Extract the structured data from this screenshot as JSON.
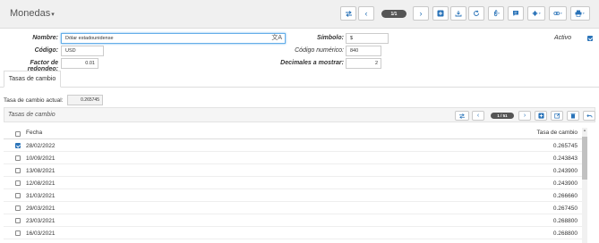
{
  "header": {
    "title": "Monedas",
    "pager": "1/1"
  },
  "form": {
    "nombre_label": "Nombre:",
    "nombre_value": "Dólar estadounidense",
    "simbolo_label": "Símbolo:",
    "simbolo_value": "$",
    "activo_label": "Activo",
    "codigo_label": "Código:",
    "codigo_value": "USD",
    "codigo_num_label": "Código numérico:",
    "codigo_num_value": "840",
    "factor_label": "Factor de redondeo:",
    "factor_value": "0.01",
    "decimales_label": "Decimales a mostrar:",
    "decimales_value": "2"
  },
  "tabs": [
    {
      "label": "Tasas de cambio"
    }
  ],
  "rate_panel": {
    "current_label": "Tasa de cambio actual:",
    "current_value": "0.265745"
  },
  "grid": {
    "title": "Tasas de cambio",
    "pager": "1 / 51",
    "col_date": "Fecha",
    "col_rate": "Tasa de cambio",
    "rows": [
      {
        "date": "28/02/2022",
        "rate": "0.265745",
        "checked": true
      },
      {
        "date": "10/09/2021",
        "rate": "0.243843",
        "checked": false
      },
      {
        "date": "13/08/2021",
        "rate": "0.243900",
        "checked": false
      },
      {
        "date": "12/08/2021",
        "rate": "0.243900",
        "checked": false
      },
      {
        "date": "31/03/2021",
        "rate": "0.266660",
        "checked": false
      },
      {
        "date": "29/03/2021",
        "rate": "0.267450",
        "checked": false
      },
      {
        "date": "23/03/2021",
        "rate": "0.268800",
        "checked": false
      },
      {
        "date": "16/03/2021",
        "rate": "0.268800",
        "checked": false
      }
    ]
  },
  "colors": {
    "accent": "#2a73b8",
    "badge": "#555555",
    "toolbar_bg": "#f0f0f0"
  }
}
